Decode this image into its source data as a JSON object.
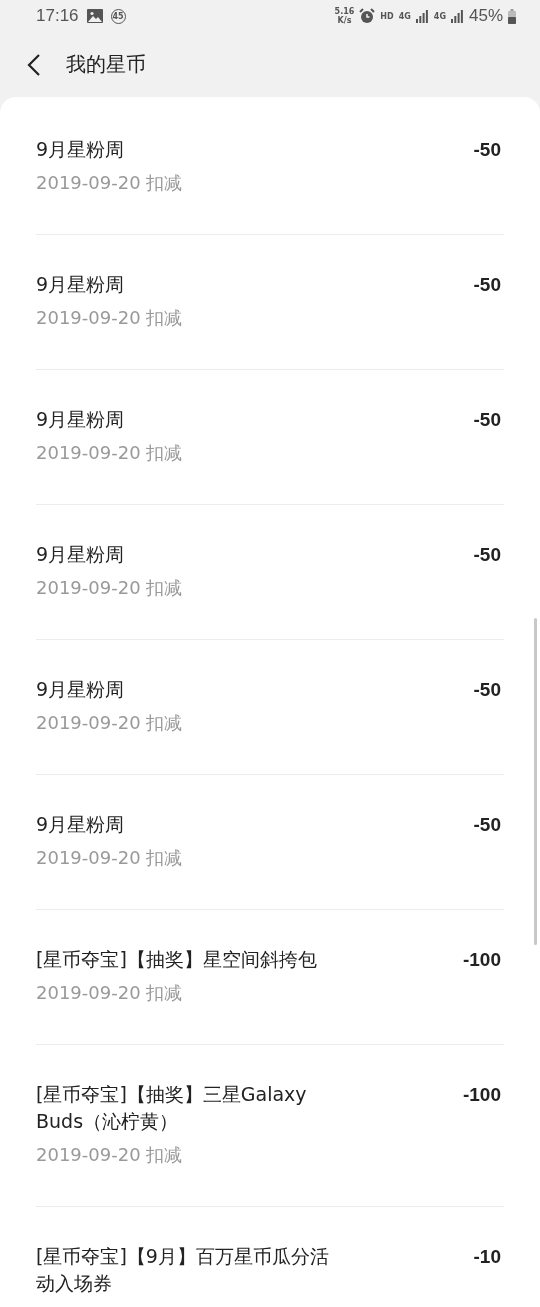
{
  "status_bar": {
    "time": "17:16",
    "notification_badge": "45",
    "net_speed": "5.16",
    "net_speed_unit": "K/s",
    "hd": "HD",
    "sim1": "4G",
    "sim2": "4G",
    "battery": "45%"
  },
  "header": {
    "title": "我的星币"
  },
  "records": [
    {
      "title": "9月星粉周",
      "amount": "-50",
      "date": "2019-09-20 扣减"
    },
    {
      "title": "9月星粉周",
      "amount": "-50",
      "date": "2019-09-20 扣减"
    },
    {
      "title": "9月星粉周",
      "amount": "-50",
      "date": "2019-09-20 扣减"
    },
    {
      "title": "9月星粉周",
      "amount": "-50",
      "date": "2019-09-20 扣减"
    },
    {
      "title": "9月星粉周",
      "amount": "-50",
      "date": "2019-09-20 扣减"
    },
    {
      "title": "9月星粉周",
      "amount": "-50",
      "date": "2019-09-20 扣减"
    },
    {
      "title": "[星币夺宝]【抽奖】星空间斜挎包",
      "amount": "-100",
      "date": "2019-09-20 扣减"
    },
    {
      "title": "[星币夺宝]【抽奖】三星Galaxy Buds（沁柠黄）",
      "amount": "-100",
      "date": "2019-09-20 扣减"
    },
    {
      "title": "[星币夺宝]【9月】百万星币瓜分活动入场券",
      "amount": "-10"
    }
  ]
}
